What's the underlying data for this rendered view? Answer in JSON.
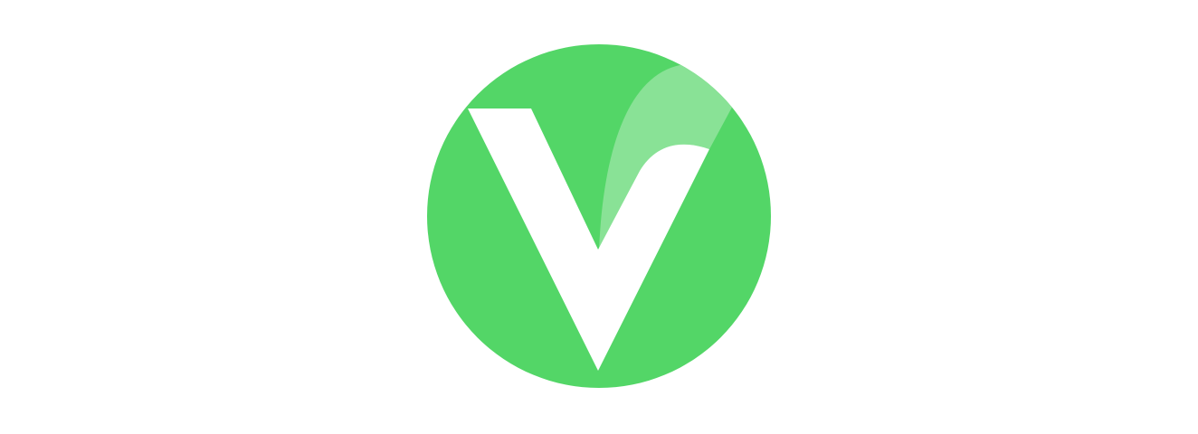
{
  "logo": {
    "name": "V logo",
    "icon": "v-checkmark-icon",
    "letter": "V",
    "colors": {
      "circle": "#53d667",
      "highlight": "#89e296",
      "letterform": "#ffffff",
      "background": "#ffffff"
    }
  }
}
